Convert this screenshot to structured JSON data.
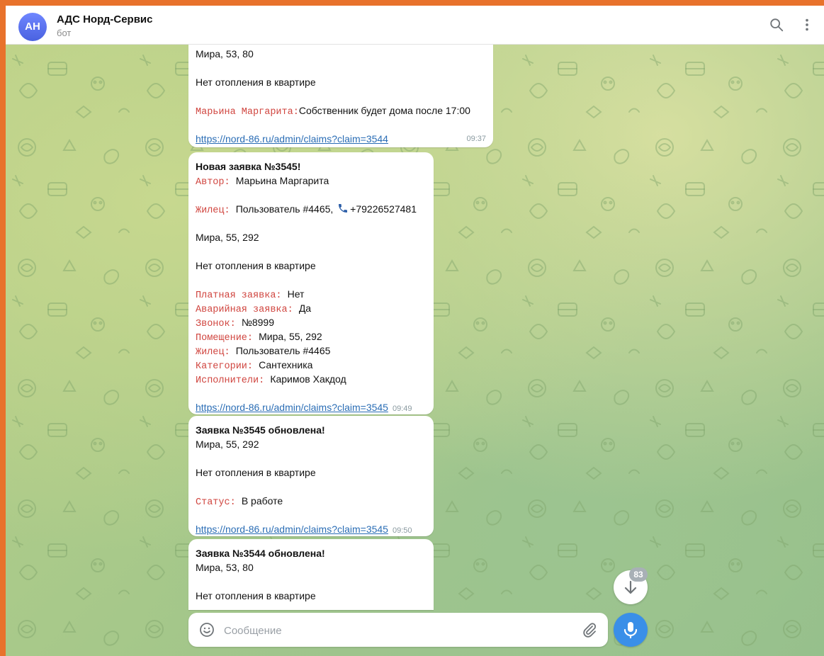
{
  "header": {
    "avatar_initials": "АН",
    "title": "АДС Норд-Сервис",
    "status": "бот",
    "icons": [
      "search-icon",
      "more-vertical-icon"
    ]
  },
  "messages": [
    {
      "address": "Мира, 53, 80",
      "description": "Нет отопления в квартире",
      "comment_key": "Марьина Маргарита",
      "comment_value": "Собственник будет дома после 17:00",
      "link": "https://nord-86.ru/admin/claims?claim=3544",
      "time": "09:37"
    },
    {
      "title": "Новая заявка №3545!",
      "author_key": "Автор",
      "author_value": "Марьина Маргарита",
      "resident_key": "Жилец",
      "resident_value": "Пользователь #4465,",
      "phone": "+79226527481",
      "address": "Мира, 55, 292",
      "description": "Нет отопления в квартире",
      "fields": [
        {
          "key": "Платная заявка",
          "value": "Нет"
        },
        {
          "key": "Аварийная заявка",
          "value": "Да"
        },
        {
          "key": "Звонок",
          "value": "№8999"
        },
        {
          "key": "Помещение",
          "value": "Мира, 55, 292"
        },
        {
          "key": "Жилец",
          "value": "Пользователь #4465"
        },
        {
          "key": "Категории",
          "value": "Сантехника"
        },
        {
          "key": "Исполнители",
          "value": "Каримов Хакдод"
        }
      ],
      "link": "https://nord-86.ru/admin/claims?claim=3545",
      "time": "09:49"
    },
    {
      "title": "Заявка №3545 обновлена!",
      "address": "Мира, 55, 292",
      "description": "Нет отопления в квартире",
      "status_key": "Статус",
      "status_value": "В работе",
      "link": "https://nord-86.ru/admin/claims?claim=3545",
      "time": "09:50"
    },
    {
      "title": "Заявка №3544 обновлена!",
      "address": "Мира, 53, 80",
      "description": "Нет отопления в квартире"
    }
  ],
  "composer": {
    "placeholder": "Сообщение",
    "icons": [
      "emoji-icon",
      "attach-icon",
      "microphone-icon"
    ]
  },
  "scroll_down": {
    "unread_count": "83"
  },
  "colors": {
    "accent": "#3a8fe8",
    "key_text": "#d0453f",
    "link": "#2a6db5",
    "frame_border": "#e8722c"
  }
}
